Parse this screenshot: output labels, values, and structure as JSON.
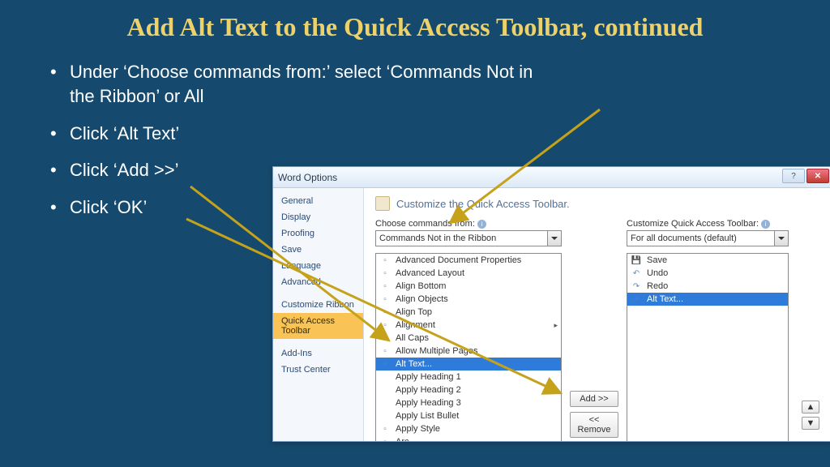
{
  "slide": {
    "title": "Add Alt Text to the Quick Access Toolbar, continued",
    "bullets": [
      "Under ‘Choose commands from:’ select ‘Commands Not in the Ribbon’ or All",
      "Click ‘Alt Text’",
      "Click ‘Add >>’",
      "Click ‘OK’"
    ]
  },
  "dialog": {
    "title": "Word Options",
    "heading": "Customize the Quick Access Toolbar.",
    "nav": {
      "items": [
        "General",
        "Display",
        "Proofing",
        "Save",
        "Language",
        "Advanced"
      ],
      "items2": [
        "Customize Ribbon",
        "Quick Access Toolbar"
      ],
      "items3": [
        "Add-Ins",
        "Trust Center"
      ],
      "selected": "Quick Access Toolbar"
    },
    "choose_label": "Choose commands from:",
    "choose_value": "Commands Not in the Ribbon",
    "customize_label": "Customize Quick Access Toolbar:",
    "customize_value": "For all documents (default)",
    "command_list": [
      "Advanced Document Properties",
      "Advanced Layout",
      "Align Bottom",
      "Align Objects",
      "Align Top",
      "Alignment",
      "All Caps",
      "Allow Multiple Pages",
      "Alt Text...",
      "Apply Heading 1",
      "Apply Heading 2",
      "Apply Heading 3",
      "Apply List Bullet",
      "Apply Style",
      "Arc"
    ],
    "command_selected": "Alt Text...",
    "qat_list": [
      "Save",
      "Undo",
      "Redo",
      "Alt Text..."
    ],
    "qat_selected": "Alt Text...",
    "add_btn": "Add >>",
    "remove_btn": "<< Remove",
    "up_btn": "▲",
    "down_btn": "▼",
    "win_help": "?",
    "win_close": "✕"
  }
}
